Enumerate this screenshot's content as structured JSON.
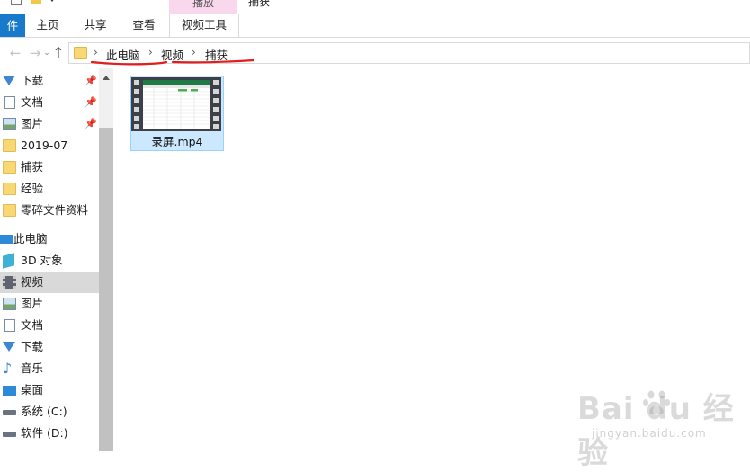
{
  "ribbon": {
    "context_group": "播放",
    "window_title": "捕获",
    "tabs": {
      "file": "件",
      "home": "主页",
      "share": "共享",
      "view": "查看",
      "video_tools": "视频工具"
    }
  },
  "navigation": {
    "back_glyph": "←",
    "forward_glyph": "→",
    "recent_glyph": "⌄",
    "up_glyph": "↑",
    "breadcrumbs": [
      "此电脑",
      "视频",
      "捕获"
    ],
    "separator": "›"
  },
  "sidebar": {
    "items": [
      {
        "label": "下载",
        "icon": "download-icon",
        "pinned": true
      },
      {
        "label": "文档",
        "icon": "document-icon",
        "pinned": true
      },
      {
        "label": "图片",
        "icon": "picture-icon",
        "pinned": true
      },
      {
        "label": "2019-07",
        "icon": "folder-icon",
        "pinned": false
      },
      {
        "label": "捕获",
        "icon": "folder-icon",
        "pinned": false
      },
      {
        "label": "经验",
        "icon": "folder-icon",
        "pinned": false
      },
      {
        "label": "零碎文件资料",
        "icon": "folder-icon",
        "pinned": false
      },
      {
        "label": "此电脑",
        "icon": "computer-icon",
        "pinned": false
      },
      {
        "label": "3D 对象",
        "icon": "cube-3d-icon",
        "pinned": false
      },
      {
        "label": "视频",
        "icon": "video-icon",
        "pinned": false,
        "selected": true
      },
      {
        "label": "图片",
        "icon": "picture-icon",
        "pinned": false
      },
      {
        "label": "文档",
        "icon": "document-icon",
        "pinned": false
      },
      {
        "label": "下载",
        "icon": "download-icon",
        "pinned": false
      },
      {
        "label": "音乐",
        "icon": "music-icon",
        "pinned": false
      },
      {
        "label": "桌面",
        "icon": "desktop-icon",
        "pinned": false
      },
      {
        "label": "系统 (C:)",
        "icon": "drive-icon",
        "pinned": false
      },
      {
        "label": "软件 (D:)",
        "icon": "drive-icon",
        "pinned": false
      }
    ],
    "pin_glyph": "📌"
  },
  "files": [
    {
      "name": "录屏.mp4",
      "icon": "video-file-icon"
    }
  ],
  "watermark": {
    "brand": "Bai du 经验",
    "url": "jingyan.baidu.com"
  },
  "colors": {
    "accent": "#1979ca",
    "selection": "#cce8ff",
    "context_tab": "#f9d7ec",
    "annotation": "#e11d1d"
  }
}
